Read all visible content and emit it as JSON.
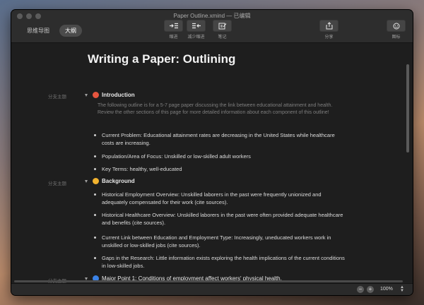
{
  "window": {
    "title": "Paper Outline.xmind — 已编辑"
  },
  "view_switch": {
    "mind_map": "思维导图",
    "outline": "大纲"
  },
  "toolbar": {
    "indent": "缩进",
    "outdent": "减少缩进",
    "notes": "笔记",
    "share": "分享",
    "icons": "图标"
  },
  "doc": {
    "title": "Writing a Paper: Outlining",
    "branch_label": "分支主题",
    "topics": [
      {
        "label": "Introduction",
        "color": "#e5553f",
        "note": "The following outline is for a 5-7 page paper discussing the link between educational attainment and health. Review the other sections of this page for more detailed information about each component of this outline!",
        "bullets": [
          "Current Problem: Educational attainment rates are decreasing in the United States while healthcare costs are increasing.",
          "Population/Area of Focus: Unskilled or low-skilled adult workers",
          "Key Terms:  healthy, well-educated"
        ]
      },
      {
        "label": "Background",
        "color": "#f2b32f",
        "bullets": [
          "Historical Employment Overview: Unskilled laborers in the past were frequently unionized and adequately compensated for their work (cite sources).",
          "Historical Healthcare Overview: Unskilled laborers in the past were often provided adequate healthcare and benefits (cite sources).",
          "Current Link between Education and Employment Type: Increasingly, uneducated workers work in unskilled or low-skilled jobs (cite sources).",
          "Gaps in the Research: Little information exists exploring the health implications of the current conditions in low-skilled jobs."
        ]
      },
      {
        "label": "Major Point 1:  Conditions of employment affect workers' physical health.",
        "color": "#3b82e6"
      }
    ]
  },
  "zoom": {
    "minus": "−",
    "plus": "+",
    "value": "100%"
  }
}
